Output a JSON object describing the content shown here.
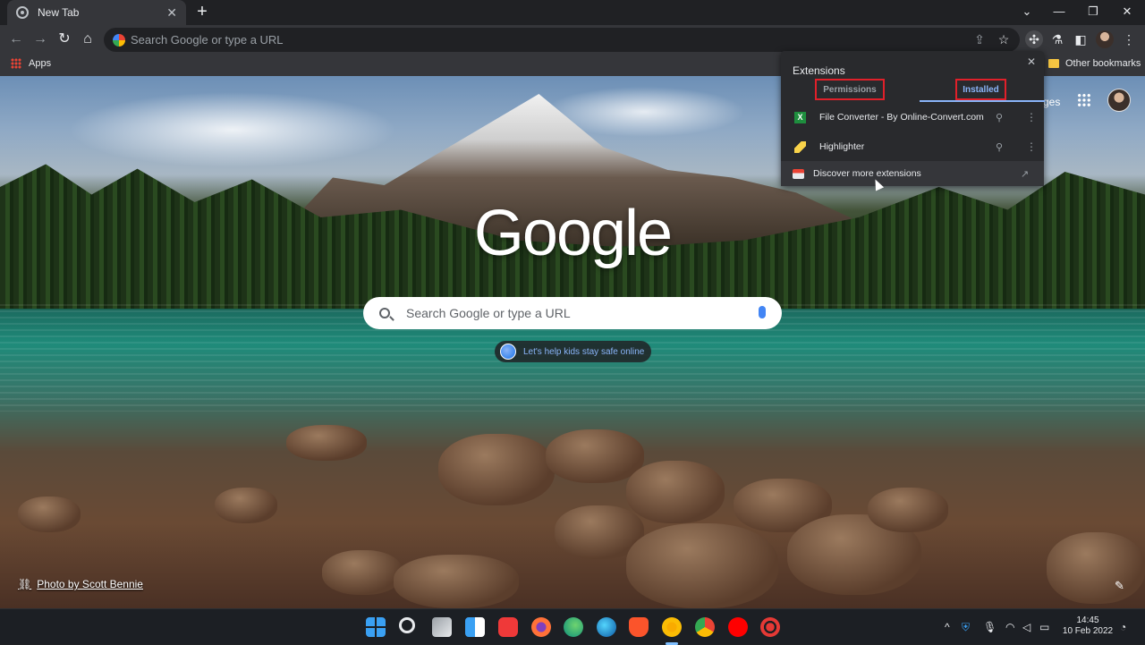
{
  "browser": {
    "tab_title": "New Tab",
    "omnibox_placeholder": "Search Google or type a URL",
    "bookmarks": {
      "apps_label": "Apps",
      "other_label": "Other bookmarks"
    }
  },
  "ntp": {
    "logo_text": "Google",
    "search_placeholder": "Search Google or type a URL",
    "promo_text": "Let's help kids stay safe online",
    "photo_credit": "Photo by Scott Bennie",
    "images_link_partial": "ges"
  },
  "extensions_popup": {
    "title": "Extensions",
    "tabs": [
      "Permissions",
      "Installed"
    ],
    "active_tab": "Installed",
    "items": [
      {
        "name": "File Converter - By Online-Convert.com",
        "icon": "file-converter-icon"
      },
      {
        "name": "Highlighter",
        "icon": "highlighter-icon"
      }
    ],
    "discover_label": "Discover more extensions"
  },
  "taskbar": {
    "apps": [
      "start",
      "search",
      "task-view",
      "widgets",
      "vivaldi",
      "firefox",
      "edge-dev",
      "edge",
      "brave",
      "chrome-canary",
      "chrome",
      "youtube-music",
      "screen-recorder"
    ],
    "time": "14:45",
    "date": "10 Feb 2022"
  },
  "colors": {
    "accent_blue": "#8ab4f8",
    "highlight_red": "#e0202a",
    "popup_bg": "#292a2d"
  }
}
